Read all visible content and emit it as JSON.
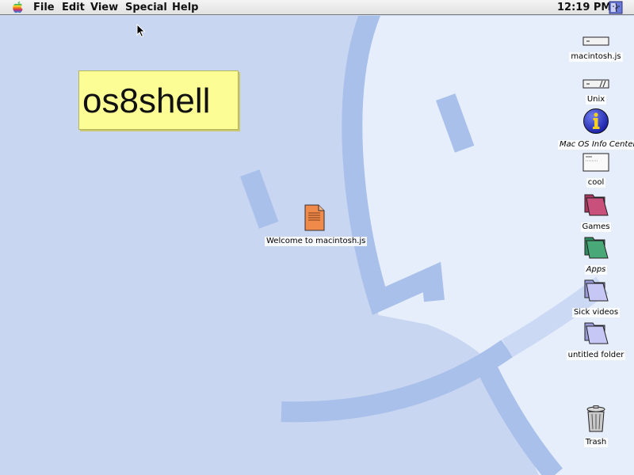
{
  "menubar": {
    "items": [
      "File",
      "Edit",
      "View",
      "Special",
      "Help"
    ],
    "clock": "12:19 PM"
  },
  "sticky": {
    "text": "os8shell"
  },
  "center_icon": {
    "label": "Welcome to macintosh.js",
    "icon": "document-icon"
  },
  "desktop_icons": [
    {
      "label": "macintosh.js",
      "icon": "hard-drive-icon"
    },
    {
      "label": "Unix",
      "icon": "hard-drive-icon"
    },
    {
      "label": "Mac OS Info Center",
      "icon": "info-icon"
    },
    {
      "label": "cool",
      "icon": "window-file-icon"
    },
    {
      "label": "Games",
      "icon": "folder-icon",
      "color": "#c8507a"
    },
    {
      "label": "Apps",
      "icon": "folder-icon",
      "color": "#48a878"
    },
    {
      "label": "Sick videos",
      "icon": "folder-icon",
      "color": "#b9b9f0"
    },
    {
      "label": "untitled folder",
      "icon": "folder-icon",
      "color": "#b9b9f0"
    },
    {
      "label": "Trash",
      "icon": "trash-icon"
    }
  ],
  "colors": {
    "desktop_bg": "#c9d6f2",
    "face_light": "#e6eefb",
    "face_stroke": "#a8bfe8",
    "sticky": "#fdfd96"
  }
}
